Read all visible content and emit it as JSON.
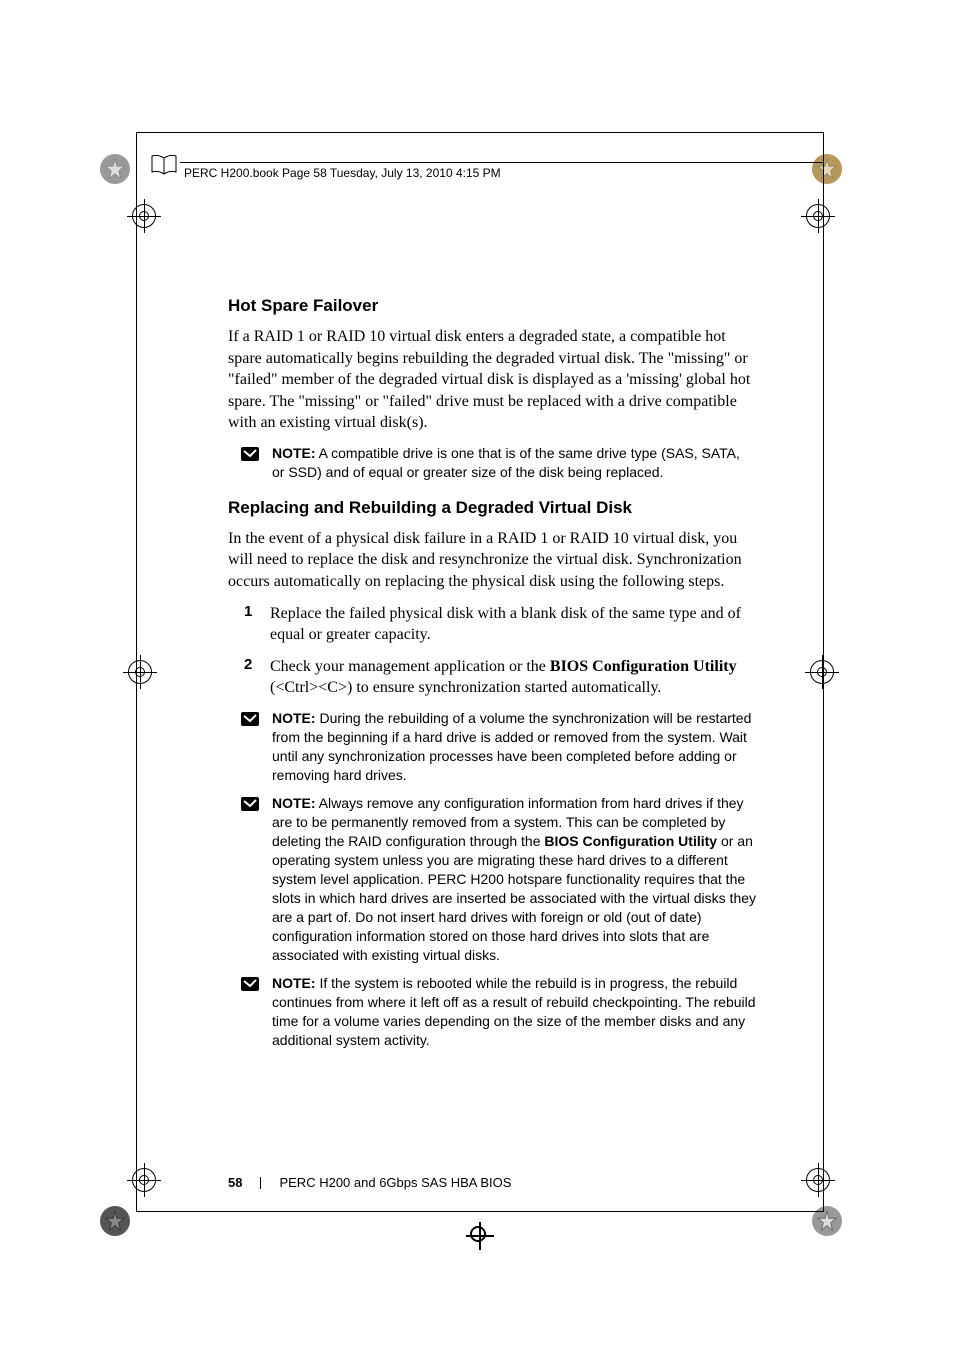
{
  "header": {
    "running_head": "PERC H200.book  Page 58  Tuesday, July 13, 2010  4:15 PM"
  },
  "section1": {
    "heading": "Hot Spare Failover",
    "paragraph": "If a RAID 1 or RAID 10 virtual disk enters a degraded state, a compatible hot spare automatically begins rebuilding the degraded virtual disk. The \"missing\" or \"failed\" member of the degraded virtual disk is displayed as a 'missing' global hot spare. The \"missing\" or \"failed\" drive must be replaced with a drive compatible with an existing virtual disk(s).",
    "note1": {
      "label": "NOTE:",
      "text": " A compatible drive is one that is of the same drive type (SAS, SATA, or SSD) and of equal or greater size of the disk being replaced."
    }
  },
  "section2": {
    "heading": "Replacing and Rebuilding a Degraded Virtual Disk",
    "paragraph": "In the event of a physical disk failure in a RAID 1 or RAID 10 virtual disk, you will need to replace the disk and resynchronize the virtual disk. Synchronization occurs automatically on replacing the physical disk using the following steps.",
    "steps": [
      {
        "num": "1",
        "text": "Replace the failed physical disk with a blank disk of the same type and of equal or greater capacity."
      },
      {
        "num": "2",
        "text_a": "Check your management application or the ",
        "text_bold": "BIOS Configuration Utility",
        "text_b": " (<Ctrl><C>) to ensure synchronization started automatically."
      }
    ],
    "note2": {
      "label": "NOTE:",
      "text": " During the rebuilding of a volume the synchronization will be restarted from the beginning if a hard drive is added or removed from the system. Wait until any synchronization processes have been completed before adding or removing hard drives."
    },
    "note3": {
      "label": "NOTE:",
      "text_a": " Always remove any configuration information from hard drives if they are to be permanently removed from a system. This can be completed by deleting the RAID configuration through the ",
      "text_bold": "BIOS Configuration Utility",
      "text_b": " or an operating system unless you are migrating these hard drives to a different system level application. PERC H200 hotspare functionality requires that the slots in which hard drives are inserted be associated with the virtual disks they are a part of. Do not insert hard drives with foreign or old (out of date) configuration information stored on those hard drives into slots that are associated with existing virtual disks."
    },
    "note4": {
      "label": "NOTE:",
      "text": " If the system is rebooted while the rebuild is in progress, the rebuild continues from where it left off as a result of rebuild checkpointing. The rebuild time for a volume varies depending on the size of the member disks and any additional system activity."
    }
  },
  "footer": {
    "page_number": "58",
    "section_title": "PERC H200 and 6Gbps SAS HBA BIOS"
  }
}
